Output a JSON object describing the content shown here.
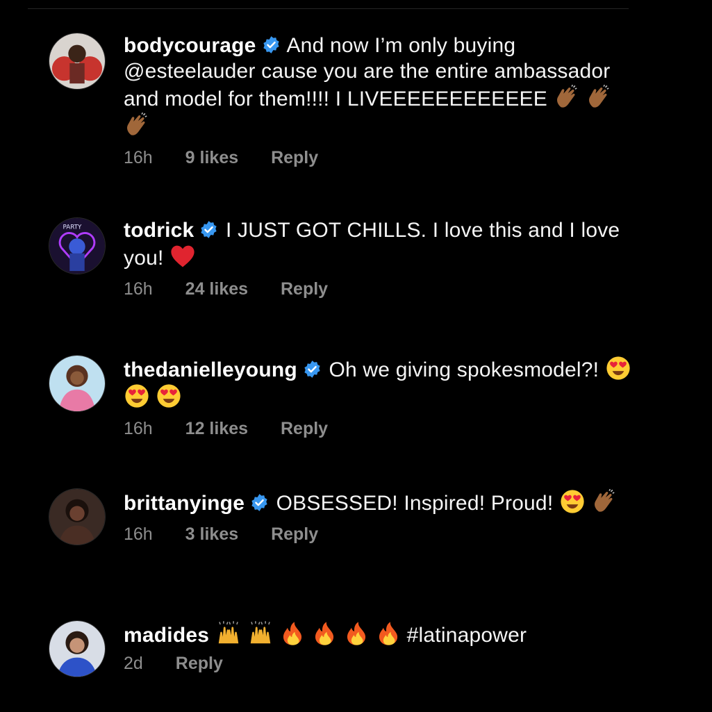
{
  "comments": [
    {
      "username": "bodycourage",
      "verified": true,
      "text_before": "And now I’m only buying @esteelauder cause you are the entire ambassador and model for them!!!! I LIVEEEEEEEEEEEE",
      "emojis": [
        "clapping-hands",
        "clapping-hands",
        "clapping-hands"
      ],
      "time": "16h",
      "likes": "9 likes",
      "reply": "Reply"
    },
    {
      "username": "todrick",
      "verified": true,
      "text_before": "I JUST GOT CHILLS. I love this and I love you!",
      "emojis": [
        "red-heart"
      ],
      "time": "16h",
      "likes": "24 likes",
      "reply": "Reply"
    },
    {
      "username": "thedanielleyoung",
      "verified": true,
      "text_before": "Oh we giving spokesmodel?!",
      "emojis": [
        "heart-eyes",
        "heart-eyes",
        "heart-eyes"
      ],
      "time": "16h",
      "likes": "12 likes",
      "reply": "Reply"
    },
    {
      "username": "brittanyinge",
      "verified": true,
      "text_before": "OBSESSED! Inspired! Proud!",
      "emojis": [
        "heart-eyes",
        "clapping-hands"
      ],
      "time": "16h",
      "likes": "3 likes",
      "reply": "Reply"
    },
    {
      "username": "madides",
      "verified": false,
      "text_before": "",
      "emojis": [
        "raising-hands",
        "raising-hands",
        "fire",
        "fire",
        "fire",
        "fire"
      ],
      "text_after": "#latinapower",
      "time": "2d",
      "reply": "Reply"
    }
  ],
  "colors": {
    "background": "#000000",
    "meta_text": "#8e8e8e",
    "verified_badge": "#3897f0"
  }
}
